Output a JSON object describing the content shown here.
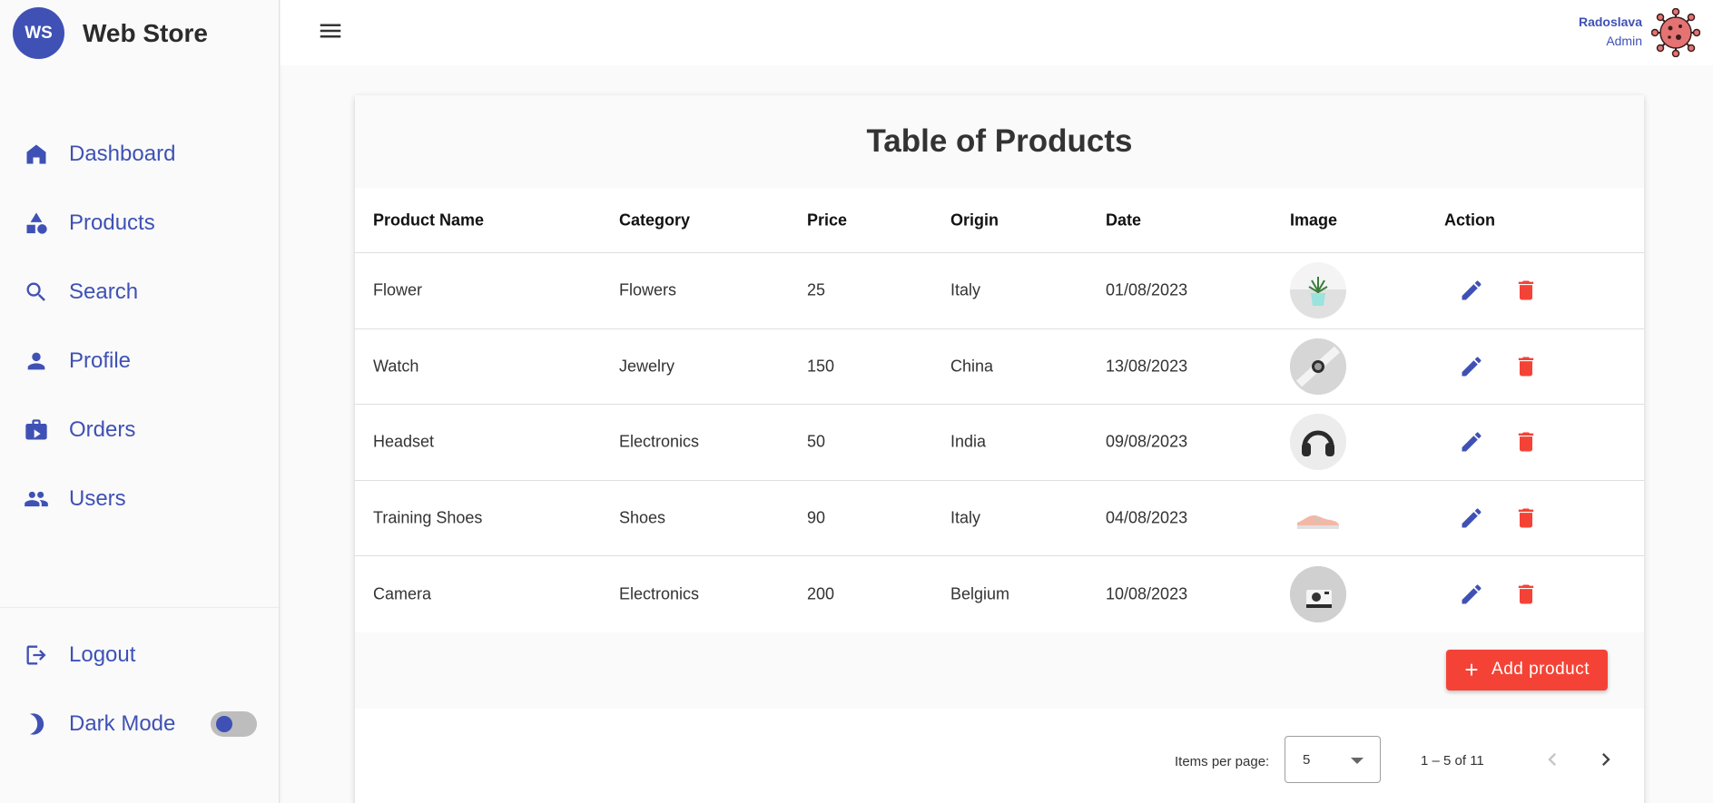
{
  "brand": {
    "logo": "WS",
    "name": "Web Store"
  },
  "nav": {
    "items": [
      {
        "label": "Dashboard",
        "icon": "home-icon"
      },
      {
        "label": "Products",
        "icon": "category-icon"
      },
      {
        "label": "Search",
        "icon": "search-icon"
      },
      {
        "label": "Profile",
        "icon": "person-icon"
      },
      {
        "label": "Orders",
        "icon": "orders-icon"
      },
      {
        "label": "Users",
        "icon": "people-icon"
      }
    ],
    "logout": "Logout",
    "dark_mode": "Dark Mode",
    "dark_mode_on": false
  },
  "header": {
    "menu_icon": "menu-icon",
    "user_name": "Radoslava",
    "user_role": "Admin",
    "avatar_icon": "virus-avatar-icon"
  },
  "table": {
    "title": "Table of Products",
    "columns": [
      "Product Name",
      "Category",
      "Price",
      "Origin",
      "Date",
      "Image",
      "Action"
    ],
    "rows": [
      {
        "name": "Flower",
        "category": "Flowers",
        "price": "25",
        "origin": "Italy",
        "date": "01/08/2023",
        "image": "plant-thumbnail"
      },
      {
        "name": "Watch",
        "category": "Jewelry",
        "price": "150",
        "origin": "China",
        "date": "13/08/2023",
        "image": "watch-thumbnail"
      },
      {
        "name": "Headset",
        "category": "Electronics",
        "price": "50",
        "origin": "India",
        "date": "09/08/2023",
        "image": "headset-thumbnail"
      },
      {
        "name": "Training Shoes",
        "category": "Shoes",
        "price": "90",
        "origin": "Italy",
        "date": "04/08/2023",
        "image": "shoes-thumbnail"
      },
      {
        "name": "Camera",
        "category": "Electronics",
        "price": "200",
        "origin": "Belgium",
        "date": "10/08/2023",
        "image": "camera-thumbnail"
      }
    ],
    "add_button": "Add product"
  },
  "paginator": {
    "items_per_page_label": "Items per page:",
    "items_per_page": "5",
    "range": "1 – 5 of 11"
  },
  "colors": {
    "primary": "#3f51b5",
    "warn": "#f44336"
  }
}
